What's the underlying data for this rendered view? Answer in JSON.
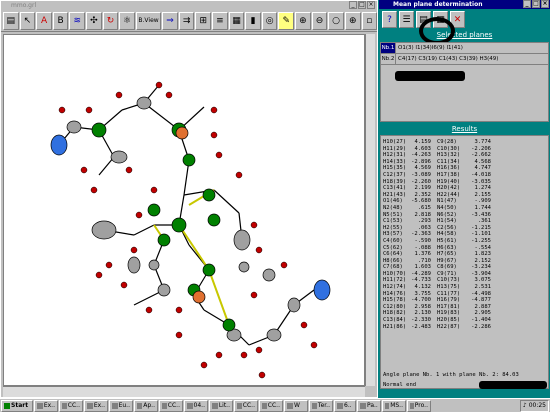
{
  "left_window": {
    "title": "mmo.grl",
    "toolbar": [
      {
        "name": "print-icon",
        "glyph": "▤"
      },
      {
        "name": "arrow-icon",
        "glyph": "↖"
      },
      {
        "name": "atom-label-icon",
        "glyph": "A"
      },
      {
        "name": "label-icon",
        "glyph": "B"
      },
      {
        "name": "hkl-icon",
        "glyph": "≋"
      },
      {
        "name": "move-icon",
        "glyph": "✣"
      },
      {
        "name": "rotate-icon",
        "glyph": "↻"
      },
      {
        "name": "zoom-in-icon",
        "glyph": "⊕"
      },
      {
        "name": "zoom-out-icon",
        "glyph": "⊖"
      },
      {
        "name": "view-icon",
        "glyph": "⚪"
      },
      {
        "name": "center-icon",
        "glyph": "⊕"
      }
    ],
    "bview_label": "B.View"
  },
  "right_window": {
    "title": "Mean plane determination",
    "selected_title": "Selected planes",
    "results_title": "Results",
    "planes": [
      {
        "num": "Nb.1",
        "atoms": "O1(3) I1(34)I6(9) I1(41)"
      },
      {
        "num": "Nb.2",
        "atoms": "C4(17) C3(19) C1(43) C3(39) H3(49)"
      }
    ],
    "results": [
      [
        "H10(27)",
        "4.159",
        "C9(28)",
        "3.774"
      ],
      [
        "H11(29)",
        "4.603",
        "C10(30)",
        "-2.206"
      ],
      [
        "H12(31)",
        "-4.263",
        "H13(32)",
        "-2.662"
      ],
      [
        "H14(33)",
        "-2.896",
        "C11(34)",
        "4.568"
      ],
      [
        "H15(35)",
        "4.569",
        "H16(36)",
        "4.747"
      ],
      [
        "C12(37)",
        "-3.089",
        "H17(38)",
        "-4.018"
      ],
      [
        "H18(39)",
        "-2.260",
        "H19(40)",
        "-3.035"
      ],
      [
        "C13(41)",
        "2.199",
        "H20(42)",
        "1.274"
      ],
      [
        "H21(43)",
        "2.352",
        "H22(44)",
        "2.155"
      ],
      [
        "O1(46)",
        "-5.680",
        "N1(47)",
        "-.909"
      ],
      [
        "N2(48)",
        ".615",
        "N4(50)",
        "1.744"
      ],
      [
        "N5(51)",
        "2.818",
        "N6(52)",
        "-3.436"
      ],
      [
        "C1(53)",
        ".293",
        "H1(54)",
        ".361"
      ],
      [
        "H2(55)",
        ".063",
        "C2(56)",
        "-1.215"
      ],
      [
        "H3(57)",
        "-2.363",
        "H4(58)",
        "-1.101"
      ],
      [
        "C4(60)",
        "-.590",
        "H5(61)",
        "-1.255"
      ],
      [
        "C5(62)",
        "-.088",
        "H6(63)",
        "-.554"
      ],
      [
        "C6(64)",
        "1.376",
        "H7(65)",
        "1.823"
      ],
      [
        "H8(66)",
        ".710",
        "H9(67)",
        "2.152"
      ],
      [
        "C7(68)",
        "1.603",
        "C8(69)",
        "-3.234"
      ],
      [
        "H10(70)",
        "-4.289",
        "C9(71)",
        "-3.904"
      ],
      [
        "H11(72)",
        "-4.733",
        "C10(73)",
        "3.075"
      ],
      [
        "H12(74)",
        "4.132",
        "H13(75)",
        "2.531"
      ],
      [
        "H14(76)",
        "3.755",
        "C11(77)",
        "-4.498"
      ],
      [
        "H15(78)",
        "-4.700",
        "H16(79)",
        "-4.877"
      ],
      [
        "C12(80)",
        "2.958",
        "H17(81)",
        "2.887"
      ],
      [
        "H18(82)",
        "2.130",
        "H19(83)",
        "2.905"
      ],
      [
        "C13(84)",
        "-2.330",
        "H20(85)",
        "-1.404"
      ],
      [
        "H21(86)",
        "-2.483",
        "H22(87)",
        "-2.286"
      ]
    ],
    "angle_text": "Angle plane Nb. 1 with plane Nb. 2: 84.03",
    "normal_end": "Normal end"
  },
  "taskbar": {
    "start": "Start",
    "tasks": [
      "Ex..",
      "CC..",
      "Ex..",
      "Eu..",
      "Ap..",
      "CC..",
      "04..",
      "Lit..",
      "CC..",
      "CC..",
      "W",
      "Ter..",
      "6..",
      "Pa..",
      "MS..",
      "Pro.."
    ],
    "clock": "00:25"
  }
}
